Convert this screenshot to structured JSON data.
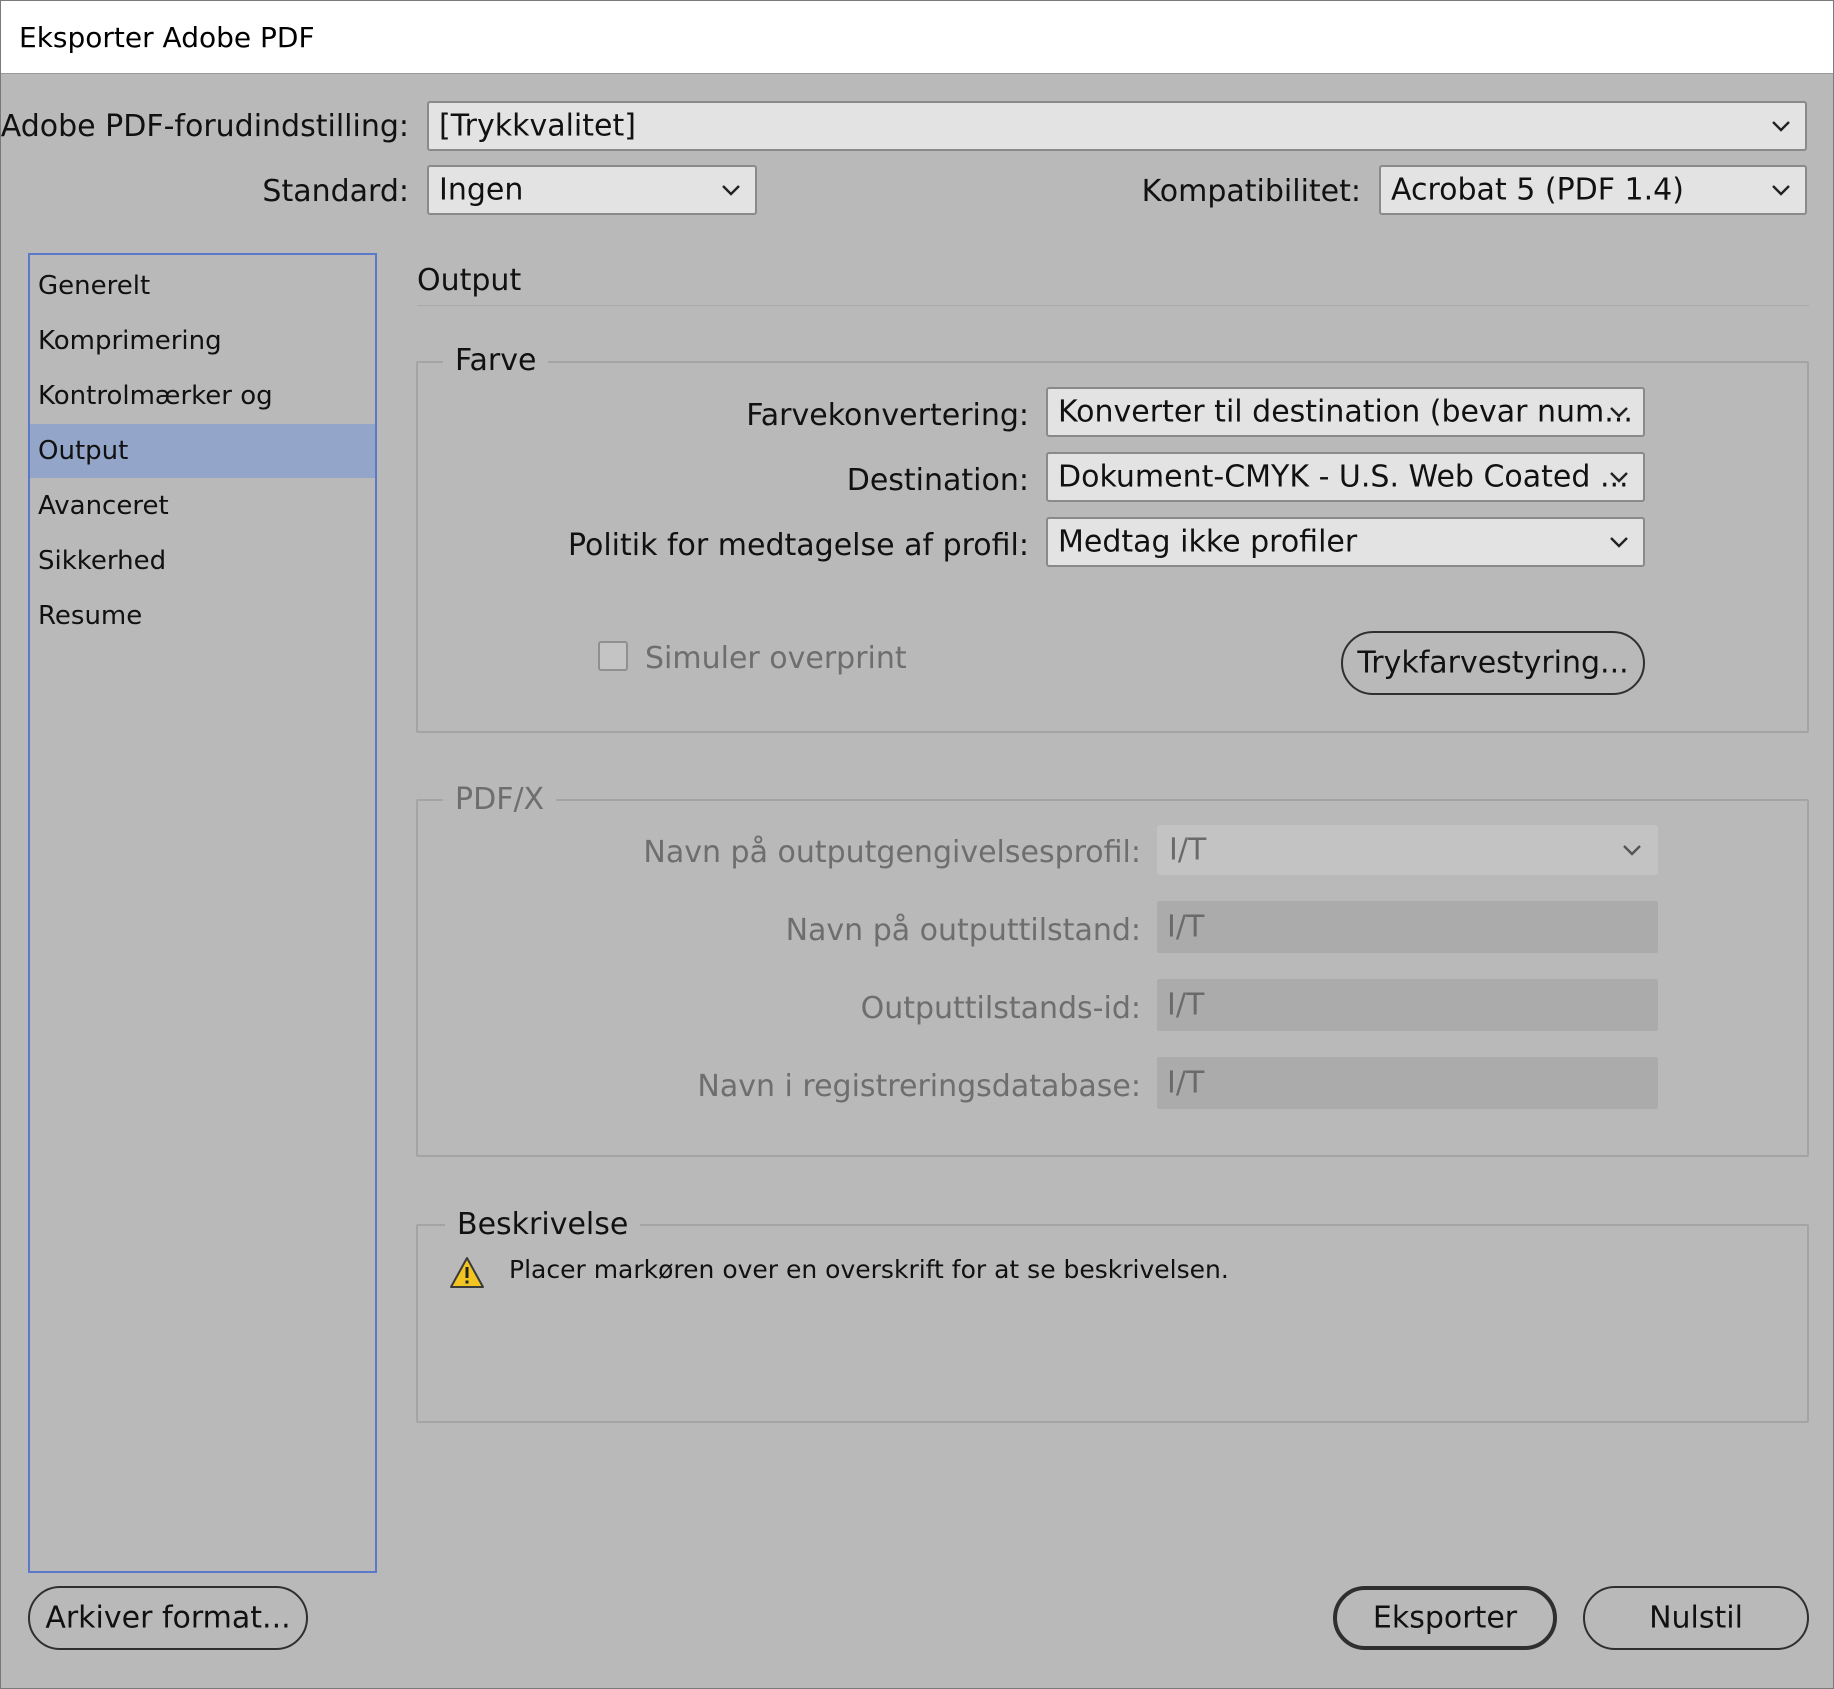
{
  "window": {
    "title": "Eksporter Adobe PDF"
  },
  "header": {
    "preset_label": "Adobe PDF-forudindstilling:",
    "preset_value": "[Trykkvalitet]",
    "standard_label": "Standard:",
    "standard_value": "Ingen",
    "compat_label": "Kompatibilitet:",
    "compat_value": "Acrobat 5 (PDF 1.4)"
  },
  "sidebar": {
    "items": [
      {
        "label": "Generelt"
      },
      {
        "label": "Komprimering"
      },
      {
        "label": "Kontrolmærker og beskæring"
      },
      {
        "label": "Output"
      },
      {
        "label": "Avanceret"
      },
      {
        "label": "Sikkerhed"
      },
      {
        "label": "Resume"
      }
    ],
    "selected": "Output"
  },
  "main": {
    "section_title": "Output",
    "color": {
      "group_title": "Farve",
      "conversion_label": "Farvekonvertering:",
      "conversion_value": "Konverter til destination (bevar num...",
      "destination_label": "Destination:",
      "destination_value": "Dokument-CMYK - U.S. Web Coated ...",
      "policy_label": "Politik for medtagelse af profil:",
      "policy_value": "Medtag ikke profiler",
      "simulate_label": "Simuler overprint",
      "ink_button": "Trykfarvestyring..."
    },
    "pdfx": {
      "group_title": "PDF/X",
      "profile_label": "Navn på outputgengivelsesprofil:",
      "profile_value": "I/T",
      "condition_label": "Navn på outputtilstand:",
      "condition_value": "I/T",
      "condition_id_label": "Outputtilstands-id:",
      "condition_id_value": "I/T",
      "registry_label": "Navn i registreringsdatabase:",
      "registry_value": "I/T"
    },
    "description": {
      "group_title": "Beskrivelse",
      "text": "Placer markøren over en overskrift for at se beskrivelsen."
    }
  },
  "footer": {
    "save_preset": "Arkiver format...",
    "export": "Eksporter",
    "reset": "Nulstil"
  }
}
